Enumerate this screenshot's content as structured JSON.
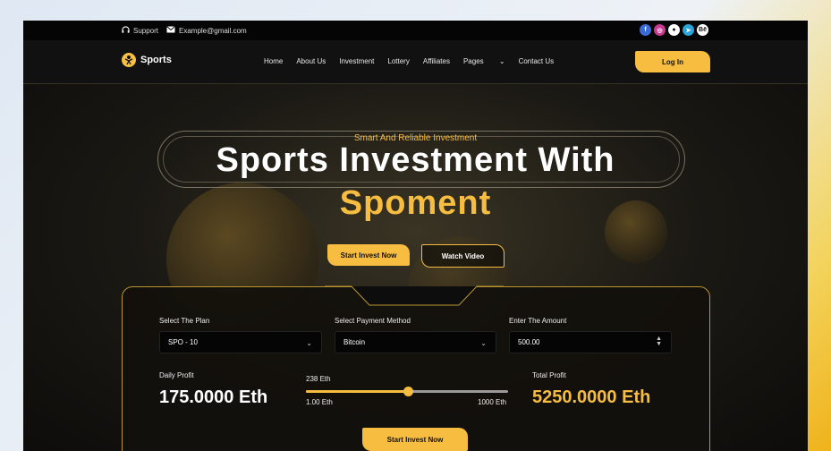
{
  "topbar": {
    "support_label": "Support",
    "email": "Example@gmail.com",
    "socials": [
      {
        "icon": "facebook-icon",
        "glyph": "f",
        "color": "#3b6bd6"
      },
      {
        "icon": "instagram-icon",
        "glyph": "◎",
        "color": "#c73a8e"
      },
      {
        "icon": "github-icon",
        "glyph": "●",
        "color": "#ffffff"
      },
      {
        "icon": "telegram-icon",
        "glyph": "➤",
        "color": "#2aa3d9"
      },
      {
        "icon": "behance-icon",
        "glyph": "Bē",
        "color": "#ffffff"
      }
    ]
  },
  "nav": {
    "brand": "Sports",
    "menu": [
      "Home",
      "About Us",
      "Investment",
      "Lottery",
      "Affiliates",
      "Pages",
      "Contact Us"
    ],
    "login": "Log In"
  },
  "hero": {
    "subtitle": "Smart And Reliable Investment",
    "title_line1": "Sports Investment With",
    "title_line2": "Spoment",
    "primary_button": "Start Invest Now",
    "secondary_button": "Watch Video"
  },
  "calculator": {
    "plan_label": "Select The Plan",
    "plan_value": "SPO - 10",
    "method_label": "Select Payment Method",
    "method_value": "Bitcoin",
    "amount_label": "Enter The Amount",
    "amount_value": "500.00",
    "daily_label": "Daily Profit",
    "daily_value": "175.0000 Eth",
    "slider_value_label": "238 Eth",
    "slider_min": "1.00 Eth",
    "slider_max": "1000 Eth",
    "slider_fraction": 0.504,
    "total_label": "Total Profit",
    "total_value": "5250.0000 Eth",
    "submit": "Start Invest Now"
  },
  "colors": {
    "accent": "#f6bd40",
    "background": "#0d0d0d"
  }
}
